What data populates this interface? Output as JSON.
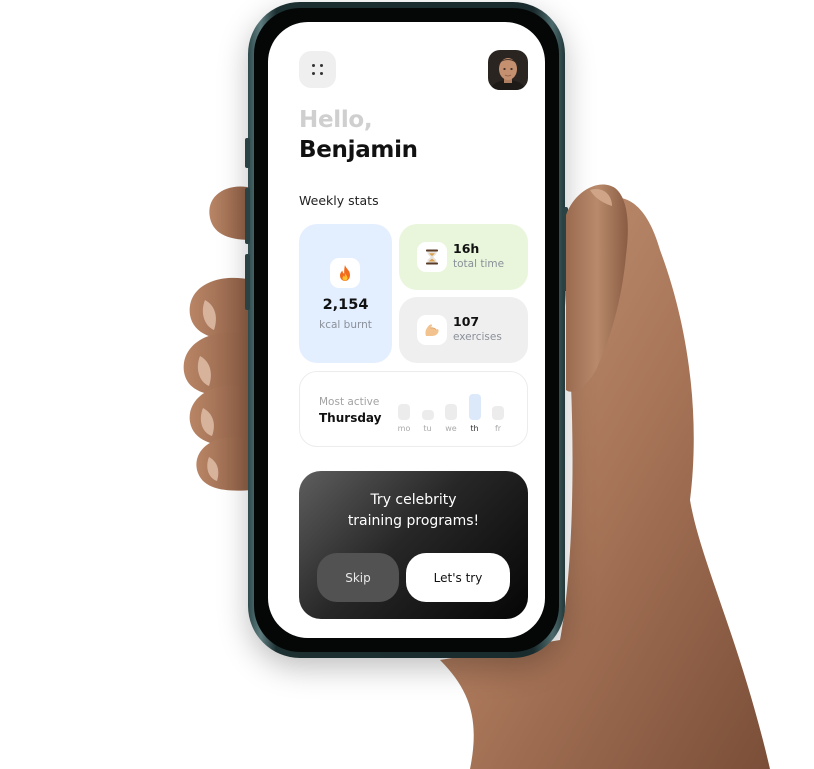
{
  "header": {
    "menu_icon": "four-dots-grid-icon",
    "avatar_icon": "user-avatar"
  },
  "greeting": {
    "hello": "Hello,",
    "name": "Benjamin"
  },
  "stats": {
    "section_title": "Weekly stats",
    "kcal": {
      "icon": "fire-icon",
      "value": "2,154",
      "label": "kcal burnt"
    },
    "time": {
      "icon": "hourglass-icon",
      "value": "16h",
      "label": "total time"
    },
    "exercises": {
      "icon": "flexed-biceps-icon",
      "value": "107",
      "label": "exercises"
    }
  },
  "most_active": {
    "label": "Most active",
    "day": "Thursday",
    "days": [
      {
        "label": "mo",
        "level": 0.45,
        "active": false
      },
      {
        "label": "tu",
        "level": 0.28,
        "active": false
      },
      {
        "label": "we",
        "level": 0.45,
        "active": false
      },
      {
        "label": "th",
        "level": 0.72,
        "active": true
      },
      {
        "label": "fr",
        "level": 0.38,
        "active": false
      }
    ]
  },
  "promo": {
    "line1": "Try celebrity",
    "line2": "training programs!",
    "skip_label": "Skip",
    "try_label": "Let's try"
  },
  "colors": {
    "kcal_card": "#e3efff",
    "time_card": "#e9f6dc",
    "exercises_card": "#efefef",
    "phone_frame": "#1c2f31",
    "promo_dark": "#050505"
  }
}
